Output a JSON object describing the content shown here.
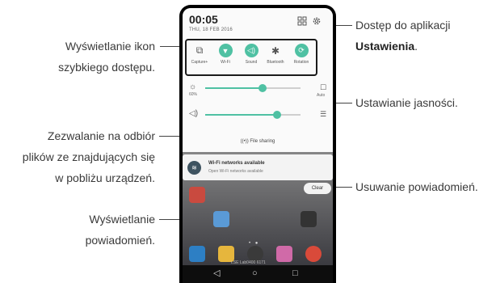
{
  "callouts": {
    "quick_access": [
      "Wyświetlanie ikon",
      "szybkiego dostępu."
    ],
    "file_sharing": [
      "Zezwalanie na odbiór",
      "plików ze znajdujących się",
      "w pobliżu urządzeń."
    ],
    "notifications": [
      "Wyświetlanie",
      "powiadomień."
    ],
    "settings_prefix": "Dostęp do aplikacji",
    "settings_bold": "Ustawienia",
    "settings_suffix": ".",
    "brightness": "Ustawianie jasności.",
    "clear": "Usuwanie powiadomień."
  },
  "phone": {
    "time": "00:05",
    "date": "THU, 18 FEB 2016",
    "quick_settings": [
      {
        "label": "Capture+",
        "icon": "capture-icon",
        "on": false,
        "glyph": "⧉"
      },
      {
        "label": "Wi-Fi",
        "icon": "wifi-icon",
        "on": true,
        "glyph": "▼"
      },
      {
        "label": "Sound",
        "icon": "sound-icon",
        "on": true,
        "glyph": "◁)"
      },
      {
        "label": "Bluetooth",
        "icon": "bluetooth-icon",
        "on": false,
        "glyph": "✱"
      },
      {
        "label": "Rotation",
        "icon": "rotation-icon",
        "on": true,
        "glyph": "⟳"
      }
    ],
    "brightness": {
      "sub": "60%",
      "end_sub": "Auto",
      "level": 0.6
    },
    "volume": {
      "level": 0.75
    },
    "file_sharing": "File sharing",
    "notification": {
      "title": "Wi-Fi networks available",
      "text": "Open Wi-Fi networks available"
    },
    "clear_label": "Clear",
    "carrier": "LSE Lab0400 6171"
  },
  "colors": {
    "accent": "#4fc1a3",
    "dark": "#1b1b1b"
  }
}
